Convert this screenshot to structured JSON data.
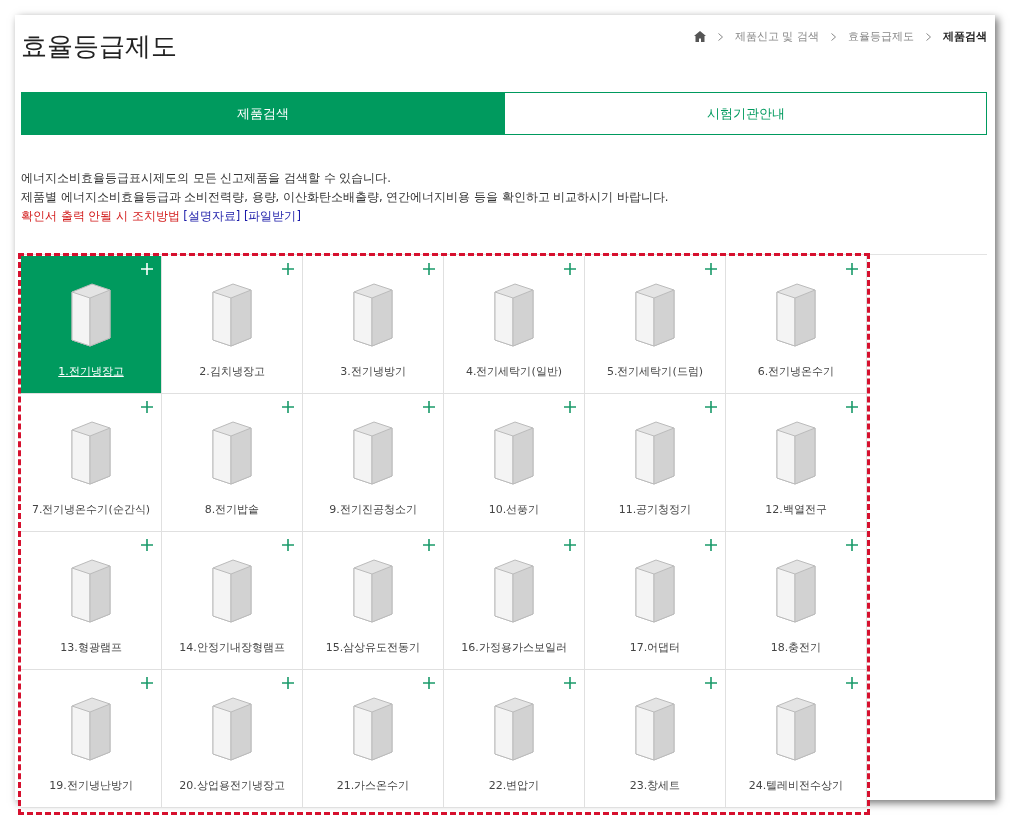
{
  "page_title": "효율등급제도",
  "breadcrumb": [
    "제품신고 및 검색",
    "효율등급제도",
    "제품검색"
  ],
  "tabs": [
    {
      "label": "제품검색",
      "selected": true
    },
    {
      "label": "시험기관안내",
      "selected": false
    }
  ],
  "intro": [
    "에너지소비효율등급표시제도의 모든 신고제품을 검색할 수 있습니다.",
    "제품별 에너지소비효율등급과 소비전력량, 용량, 이산화탄소배출량, 연간에너지비용 등을 확인하고 비교하시기 바랍니다."
  ],
  "notice": {
    "text": "확인서 출력 안될 시 조치방법",
    "links": [
      "[설명자료]",
      "[파일받기]"
    ]
  },
  "products": [
    {
      "label": "1.전기냉장고",
      "selected": true
    },
    {
      "label": "2.김치냉장고",
      "selected": false
    },
    {
      "label": "3.전기냉방기",
      "selected": false
    },
    {
      "label": "4.전기세탁기(일반)",
      "selected": false
    },
    {
      "label": "5.전기세탁기(드럼)",
      "selected": false
    },
    {
      "label": "6.전기냉온수기",
      "selected": false
    },
    {
      "label": "7.전기냉온수기(순간식)",
      "selected": false
    },
    {
      "label": "8.전기밥솥",
      "selected": false
    },
    {
      "label": "9.전기진공청소기",
      "selected": false
    },
    {
      "label": "10.선풍기",
      "selected": false
    },
    {
      "label": "11.공기청정기",
      "selected": false
    },
    {
      "label": "12.백열전구",
      "selected": false
    },
    {
      "label": "13.형광램프",
      "selected": false
    },
    {
      "label": "14.안정기내장형램프",
      "selected": false
    },
    {
      "label": "15.삼상유도전동기",
      "selected": false
    },
    {
      "label": "16.가정용가스보일러",
      "selected": false
    },
    {
      "label": "17.어댑터",
      "selected": false
    },
    {
      "label": "18.충전기",
      "selected": false
    },
    {
      "label": "19.전기냉난방기",
      "selected": false
    },
    {
      "label": "20.상업용전기냉장고",
      "selected": false
    },
    {
      "label": "21.가스온수기",
      "selected": false
    },
    {
      "label": "22.변압기",
      "selected": false
    },
    {
      "label": "23.창세트",
      "selected": false
    },
    {
      "label": "24.텔레비전수상기",
      "selected": false
    }
  ]
}
